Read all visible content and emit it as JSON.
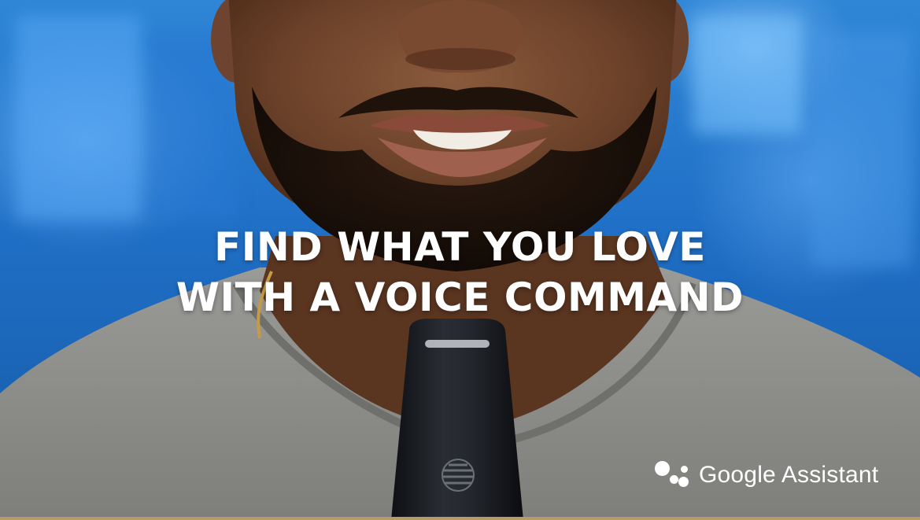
{
  "headline": {
    "line1": "FIND WHAT YOU LOVE",
    "line2": "WITH A VOICE COMMAND"
  },
  "brand": {
    "assistant_label": "Google Assistant",
    "logo_icon": "google-assistant-dots-icon",
    "remote_logo_icon": "att-globe-icon"
  },
  "colors": {
    "background_blue": "#1f6fc6",
    "shirt_gray": "#8d8d8b",
    "remote_black": "#1b1d22",
    "text_white": "#ffffff"
  }
}
